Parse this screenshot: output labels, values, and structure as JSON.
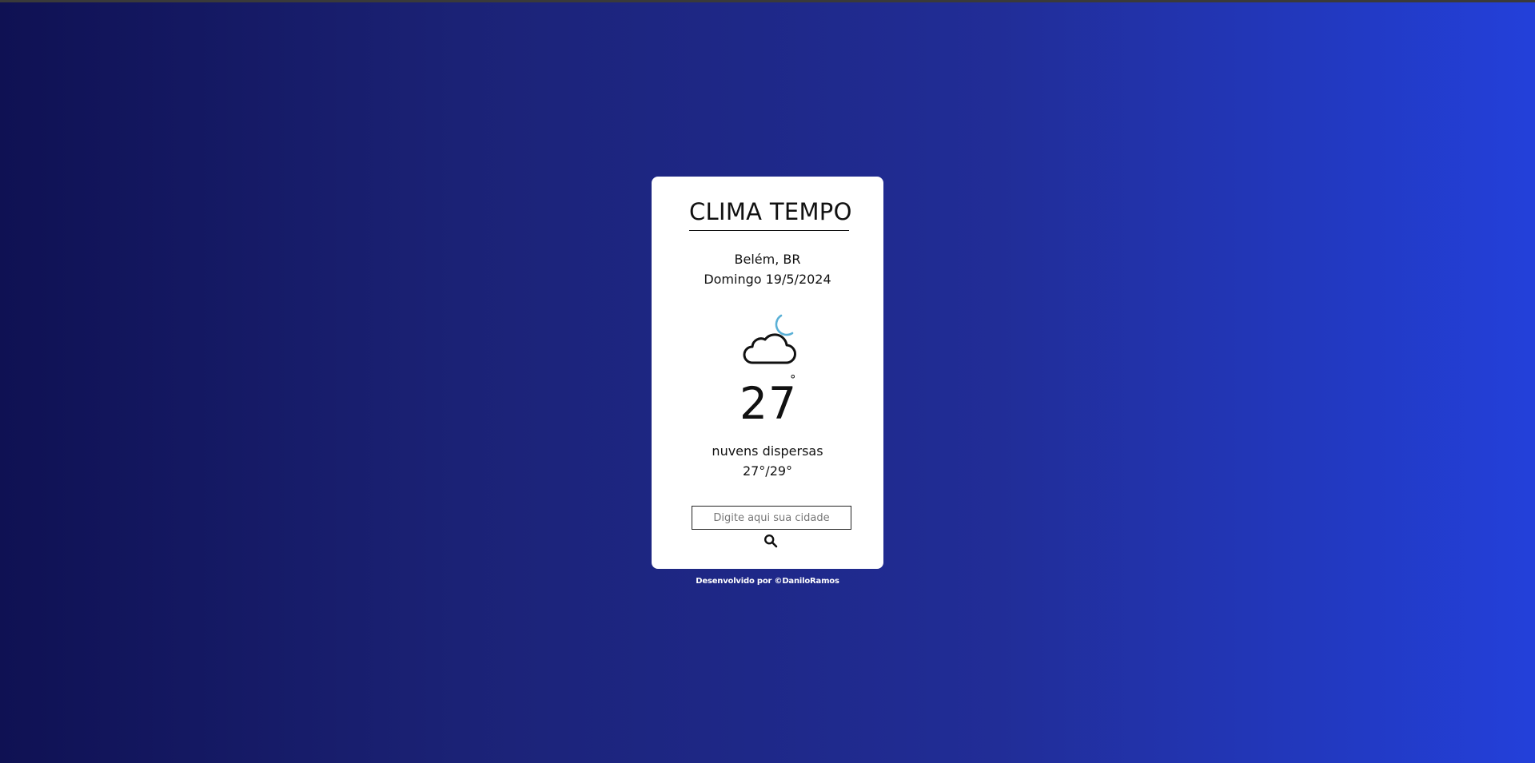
{
  "app": {
    "title": "CLIMA TEMPO"
  },
  "weather": {
    "location": "Belém, BR",
    "date": "Domingo 19/5/2024",
    "icon": "cloud-moon-icon",
    "temperature": "27",
    "degree_symbol": "°",
    "description": "nuvens dispersas",
    "min_max": "27°/29°"
  },
  "search": {
    "placeholder": "Digite aqui sua cidade",
    "value": "",
    "button_icon": "search-icon"
  },
  "footer": {
    "text": "Desenvolvido por ©DaniloRamos"
  },
  "colors": {
    "background_start": "#0f1153",
    "background_end": "#2340da",
    "card": "#ffffff",
    "moon_accent": "#5ab0d6"
  }
}
